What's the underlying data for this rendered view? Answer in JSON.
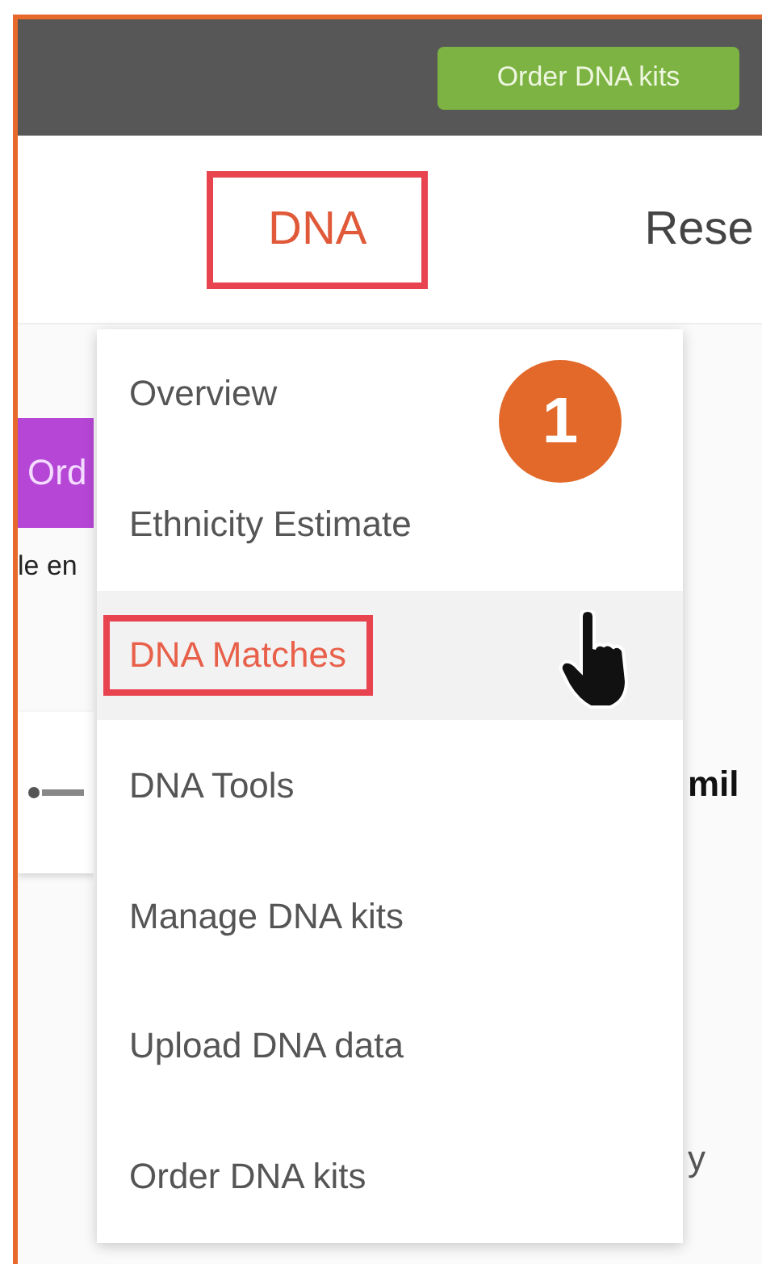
{
  "header": {
    "button": "Order DNA kits"
  },
  "nav": {
    "tabs": [
      {
        "label": "DNA",
        "selected": true,
        "highlighted": true
      },
      {
        "label": "Rese",
        "selected": false,
        "highlighted": false
      }
    ]
  },
  "background": {
    "left_button": "Ord",
    "left_text": "le en",
    "right_heading": "mil",
    "right_text": "y"
  },
  "menu": {
    "items": [
      {
        "label": "Overview",
        "hovered": false,
        "highlighted": false
      },
      {
        "label": "Ethnicity Estimate",
        "hovered": false,
        "highlighted": false
      },
      {
        "label": "DNA Matches",
        "hovered": true,
        "highlighted": true
      },
      {
        "label": "DNA Tools",
        "hovered": false,
        "highlighted": false
      },
      {
        "label": "Manage DNA kits",
        "hovered": false,
        "highlighted": false
      },
      {
        "label": "Upload DNA data",
        "hovered": false,
        "highlighted": false
      },
      {
        "label": "Order DNA kits",
        "hovered": false,
        "highlighted": false
      }
    ]
  },
  "step_badge": "1"
}
